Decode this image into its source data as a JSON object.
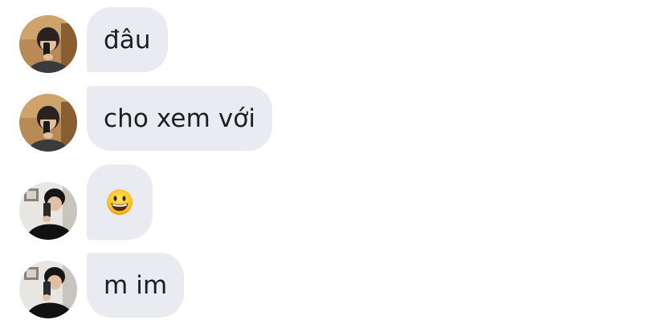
{
  "messages": [
    {
      "sender": "user-a",
      "text": "đâu"
    },
    {
      "sender": "user-a",
      "text": "cho xem với"
    },
    {
      "sender": "user-b",
      "text": "",
      "emoji": "grinning-face"
    },
    {
      "sender": "user-b",
      "text": "m im"
    }
  ],
  "colors": {
    "bubble": "#e9ebf0",
    "text": "#1c1e21",
    "background": "#ffffff"
  }
}
